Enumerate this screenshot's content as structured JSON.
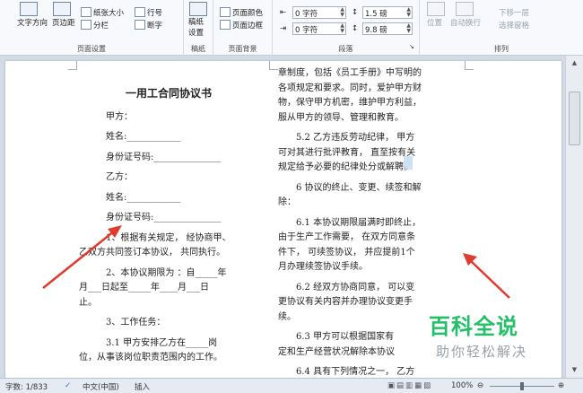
{
  "ribbon": {
    "page_setup": {
      "text_direction": "文字方向",
      "margins": "页边距",
      "paper_size": "纸张大小",
      "columns": "分栏",
      "line_numbers": "行号",
      "hyphenation": "断字",
      "group_label": "页面设置"
    },
    "draft": {
      "label": "稿纸\n设置",
      "group_label": "稿纸"
    },
    "page_background": {
      "page_color": "页面颜色",
      "page_borders": "页面边框",
      "group_label": "页面背景"
    },
    "paragraph": {
      "indent_left": "0 字符",
      "indent_right": "0 字符",
      "spacing_before": "1.5 磅",
      "spacing_after": "9.8 磅",
      "group_label": "段落"
    },
    "arrange": {
      "position": "位置",
      "wrap_text": "自动换行",
      "send_backward": "下移一层",
      "selection_pane": "选择窗格",
      "group_label": "排列"
    }
  },
  "document": {
    "left_column": {
      "title": "一用工合同协议书",
      "lines": [
        "甲方：",
        "姓名:____________",
        "身份证号码:_______________",
        "乙方：",
        "姓名:____________",
        "身份证号码:_______________",
        "1、根据有关规定， 经协商甲、",
        "乙双方共同签订本协议， 共同执行。",
        "2、本协议期限为 ：自_____年",
        "月___日起至_____年____月___日",
        "止。",
        "3、工作任务：",
        "3.1 甲方安排乙方在_____岗",
        "位，从事该岗位职责范围内的工作。"
      ]
    },
    "right_column": {
      "lines": [
        "章制度，包括《员工手册》中写明的",
        "各项规定和要求。同时，爱护甲方财",
        "物，保守甲方机密，维护甲方利益，",
        "服从甲方的领导、管理和教育。",
        "5.2 乙方违反劳动纪律， 甲方",
        "可对其进行批评教育， 直至按有关",
        "规定给予必要的纪律处分或解聘。",
        "6 协议的终止、变更、续签和解",
        "除：",
        "6.1 本协议期限届满时即终止，",
        "由于生产工作需要， 在双方同意条",
        "件下， 可续签协议， 并应提前1个",
        "月办理续签协议手续。",
        "6.2 经双方协商同意， 可以变",
        "更协议有关内容并办理协议变更手",
        "续。",
        "6.3 甲方可以根据国家有",
        "定和生产经营状况解除本协议",
        "6.4 具有下列情况之一， 乙方"
      ]
    }
  },
  "watermark": {
    "title": "百科全说",
    "subtitle": "助你轻松解决"
  },
  "status_bar": {
    "word_count": "字数: 1/833",
    "language": "中文(中国)",
    "insert_mode": "插入",
    "zoom": "100%"
  },
  "colors": {
    "watermark_green": "#22c067",
    "arrow_red": "#e03b2d",
    "selection": "#b8d3f0"
  }
}
